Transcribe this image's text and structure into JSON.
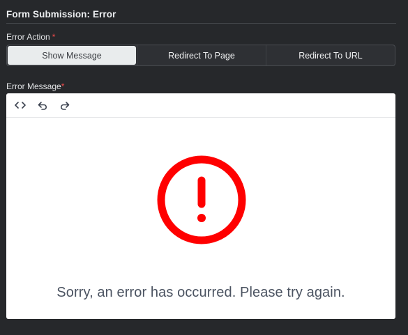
{
  "section": {
    "title": "Form Submission: Error"
  },
  "error_action": {
    "label": "Error Action",
    "required_mark": "*",
    "options": [
      "Show Message",
      "Redirect To Page",
      "Redirect To URL"
    ],
    "selected": "Show Message"
  },
  "error_message": {
    "label": "Error Message",
    "required_mark": "*",
    "toolbar": {
      "icons": [
        "code-view-icon",
        "undo-icon",
        "redo-icon"
      ]
    },
    "content": {
      "icon": "exclamation-circle-icon",
      "icon_color": "#ff0000",
      "text": "Sorry, an error has occurred. Please try again."
    }
  },
  "colors": {
    "background": "#26282b",
    "selected_option_bg": "#e9eced",
    "required": "#ef4b4b"
  }
}
